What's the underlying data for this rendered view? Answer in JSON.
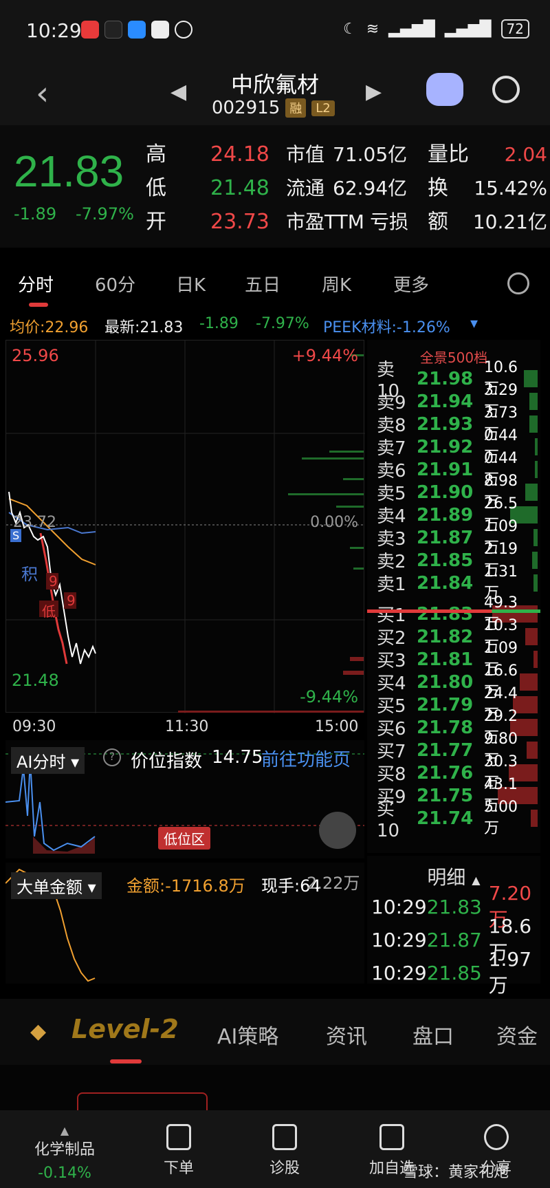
{
  "status": {
    "time": "10:29",
    "battery": "72"
  },
  "nav": {
    "title": "中欣氟材",
    "code": "002915",
    "tag1": "融",
    "tag2": "L2"
  },
  "quote": {
    "price": "21.83",
    "change": "-1.89",
    "pct": "-7.97%",
    "rows": [
      {
        "k1": "高",
        "v1": "24.18",
        "k2": "市值",
        "v2": "71.05亿",
        "k3": "量比",
        "v3": "2.04"
      },
      {
        "k1": "低",
        "v1": "21.48",
        "k2": "流通",
        "v2": "62.94亿",
        "k3": "换",
        "v3": "15.42%"
      },
      {
        "k1": "开",
        "v1": "23.73",
        "k2": "市盈TTM",
        "v2": "亏损",
        "k3": "额",
        "v3": "10.21亿"
      }
    ]
  },
  "tabs": [
    "分时",
    "60分",
    "日K",
    "五日",
    "周K",
    "更多"
  ],
  "infobar": {
    "avg": "均价:22.96",
    "latest": "最新:21.83",
    "chg": "-1.89",
    "pct": "-7.97%",
    "sector": "PEEK材料:-1.26%"
  },
  "chart": {
    "high_label": "25.96",
    "low_label": "21.48",
    "mid_label": "23.72",
    "high_pct": "+9.44%",
    "mid_pct": "0.00%",
    "low_pct": "-9.44%",
    "mark_s": "S",
    "mark_ji": "积",
    "mark_9a": "9",
    "mark_di": "低",
    "mark_9b": "9"
  },
  "time_axis": [
    "09:30",
    "11:30",
    "15:00"
  ],
  "orderbook": {
    "title": "全景500档",
    "asks": [
      {
        "label": "卖10",
        "price": "21.98",
        "vol": "10.6万",
        "w": 20
      },
      {
        "label": "卖9",
        "price": "21.94",
        "vol": "3.29万",
        "w": 12
      },
      {
        "label": "卖8",
        "price": "21.93",
        "vol": "3.73万",
        "w": 12
      },
      {
        "label": "卖7",
        "price": "21.92",
        "vol": "0.44万",
        "w": 4
      },
      {
        "label": "卖6",
        "price": "21.91",
        "vol": "0.44万",
        "w": 4
      },
      {
        "label": "卖5",
        "price": "21.90",
        "vol": "8.98万",
        "w": 18
      },
      {
        "label": "卖4",
        "price": "21.89",
        "vol": "26.5万",
        "w": 40
      },
      {
        "label": "卖3",
        "price": "21.87",
        "vol": "1.09万",
        "w": 6
      },
      {
        "label": "卖2",
        "price": "21.85",
        "vol": "2.19万",
        "w": 8
      },
      {
        "label": "卖1",
        "price": "21.84",
        "vol": "1.31万",
        "w": 6
      }
    ],
    "bids": [
      {
        "label": "买1",
        "price": "21.83",
        "vol": "49.3万",
        "w": 66
      },
      {
        "label": "买2",
        "price": "21.82",
        "vol": "10.3万",
        "w": 18
      },
      {
        "label": "买3",
        "price": "21.81",
        "vol": "1.09万",
        "w": 6
      },
      {
        "label": "买4",
        "price": "21.80",
        "vol": "16.6万",
        "w": 26
      },
      {
        "label": "买5",
        "price": "21.79",
        "vol": "24.4万",
        "w": 36
      },
      {
        "label": "买6",
        "price": "21.78",
        "vol": "29.2万",
        "w": 40
      },
      {
        "label": "买7",
        "price": "21.77",
        "vol": "9.80万",
        "w": 16
      },
      {
        "label": "买8",
        "price": "21.76",
        "vol": "30.3万",
        "w": 42
      },
      {
        "label": "买9",
        "price": "21.75",
        "vol": "43.1万",
        "w": 58
      },
      {
        "label": "买10",
        "price": "21.74",
        "vol": "5.00万",
        "w": 10
      }
    ]
  },
  "ai": {
    "selector": "AI分时",
    "label": "价位指数",
    "value": "14.75",
    "link": "前往功能页",
    "zone": "低位区"
  },
  "bigorder": {
    "selector": "大单金额",
    "amount": "金额:-1716.8万",
    "hand": "现手:64",
    "extra": "2.22万"
  },
  "detail": {
    "title": "明细",
    "rows": [
      {
        "t": "10:29",
        "p": "21.83",
        "v": "7.20万",
        "vc": "red"
      },
      {
        "t": "10:29",
        "p": "21.87",
        "v": "18.6万",
        "vc": "white"
      },
      {
        "t": "10:29",
        "p": "21.85",
        "v": "1.97万",
        "vc": "white"
      }
    ]
  },
  "bottomtabs": [
    "Level-2",
    "AI策略",
    "资讯",
    "盘口",
    "资金"
  ],
  "bnav": {
    "sector": "化学制品",
    "sector_pct": "-0.14%",
    "items": [
      "下单",
      "诊股",
      "加自选",
      "分享"
    ],
    "watermark": "雪球：黄家礼炮"
  }
}
